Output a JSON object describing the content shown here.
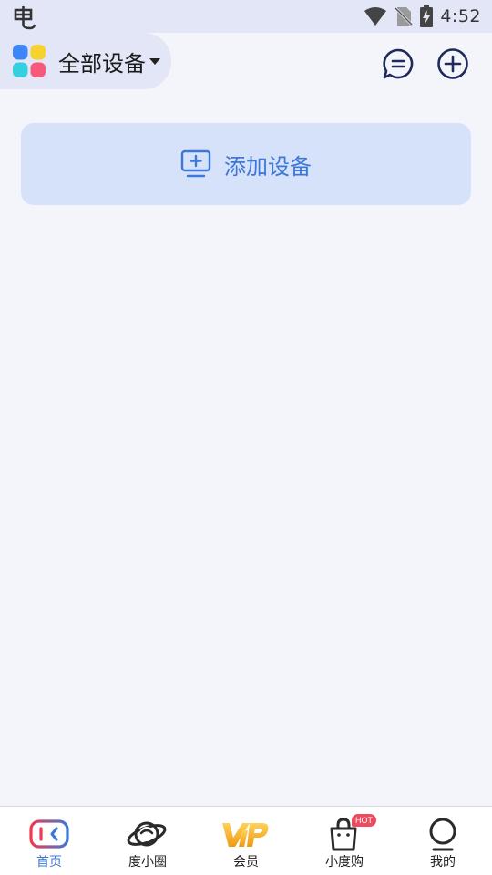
{
  "status_bar": {
    "time": "4:52",
    "icons": [
      "app-notification-icon",
      "wifi-icon",
      "no-sim-icon",
      "battery-charging-icon"
    ]
  },
  "header": {
    "device_filter_label": "全部设备",
    "icons": [
      "device-grid-icon",
      "caret-down-icon",
      "message-icon",
      "add-circle-icon"
    ]
  },
  "main": {
    "add_device_label": "添加设备",
    "add_device_icon": "monitor-plus-icon"
  },
  "bottom_nav": {
    "items": [
      {
        "label": "首页",
        "icon": "home-icon",
        "active": true
      },
      {
        "label": "度小圈",
        "icon": "planet-icon",
        "active": false
      },
      {
        "label": "会员",
        "icon": "vip-icon",
        "active": false
      },
      {
        "label": "小度购",
        "icon": "shopping-bag-icon",
        "active": false,
        "badge": "HOT"
      },
      {
        "label": "我的",
        "icon": "profile-icon",
        "active": false
      }
    ]
  },
  "colors": {
    "accent": "#3d78d8",
    "card_bg": "#d6e2fa",
    "header_bg": "#e2e6f6",
    "page_bg": "#f3f5fa",
    "badge": "#ef4b5f",
    "vip_gold": "#f2b227"
  }
}
